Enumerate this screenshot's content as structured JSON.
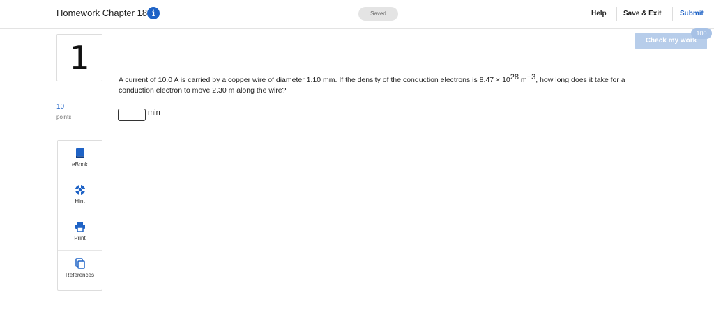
{
  "header": {
    "title": "Homework Chapter 18",
    "info_icon": "info-icon",
    "saved": "Saved",
    "help": "Help",
    "save_exit": "Save & Exit",
    "submit": "Submit"
  },
  "check_work": {
    "label": "Check my work",
    "badge": "100"
  },
  "question": {
    "number": "1",
    "points_value": "10",
    "points_label": "points",
    "text_before_exp1": "A current of 10.0 A is carried by a copper wire of diameter 1.10 mm. If the density of the conduction electrons is 8.47 × 10",
    "exp1": "28",
    "unit_m": " m",
    "exp2": "−3",
    "text_after": ", how long does it take for a conduction electron to move 2.30 m along the wire?",
    "answer_value": "",
    "answer_unit": "min"
  },
  "tools": [
    {
      "label": "eBook",
      "icon": "book-icon"
    },
    {
      "label": "Hint",
      "icon": "lifebuoy-icon"
    },
    {
      "label": "Print",
      "icon": "printer-icon"
    },
    {
      "label": "References",
      "icon": "documents-icon"
    }
  ],
  "colors": {
    "accent": "#1f63c6",
    "check_button": "#b7cdea"
  }
}
